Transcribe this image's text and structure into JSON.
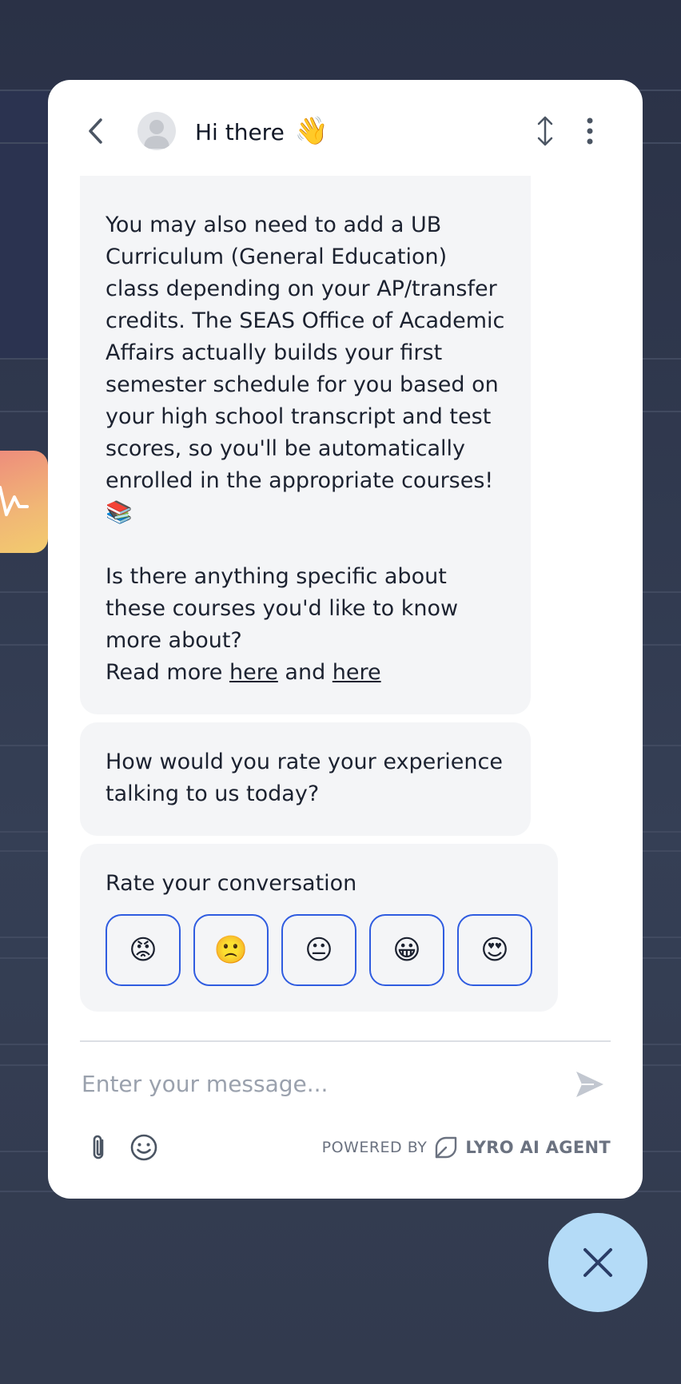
{
  "colors": {
    "page_background": "#2f374c",
    "widget_background": "#ffffff",
    "bubble_background": "#f4f5f7",
    "rating_border": "#2f5ce0",
    "close_button": "#b4dbf7",
    "close_icon": "#2a3c66"
  },
  "header": {
    "title": "Hi there",
    "title_emoji": "👋",
    "back_icon": "chevron-left-icon",
    "expand_icon": "expand-vertical-icon",
    "menu_icon": "more-vertical-icon"
  },
  "messages": [
    {
      "paragraph_1": "You may also need to add a UB Curriculum (General Education) class depending on your AP/transfer credits. The SEAS Office of Academic Affairs actually builds your first semester schedule for you based on your high school transcript and test scores, so you'll be automatically enrolled in the appropriate courses!",
      "paragraph_1_emoji": "📚",
      "paragraph_2": "Is there anything specific about these courses you'd like to know more about?",
      "read_more_prefix": "Read more",
      "link_1": "here",
      "conjunction": "and",
      "link_2": "here"
    },
    {
      "text": "How would you rate your experience talking to us today?"
    }
  ],
  "rating": {
    "title": "Rate your conversation",
    "options": [
      {
        "emoji": "😡",
        "name": "angry"
      },
      {
        "emoji": "🙁",
        "name": "sad"
      },
      {
        "emoji": "😐",
        "name": "neutral"
      },
      {
        "emoji": "😀",
        "name": "happy"
      },
      {
        "emoji": "😍",
        "name": "love"
      }
    ]
  },
  "composer": {
    "placeholder": "Enter your message...",
    "send_icon": "send-icon",
    "attach_icon": "paperclip-icon",
    "emoji_icon": "smiley-icon"
  },
  "footer": {
    "powered_by": "POWERED BY",
    "brand": "LYRO AI AGENT"
  },
  "close_button_icon": "close-icon"
}
